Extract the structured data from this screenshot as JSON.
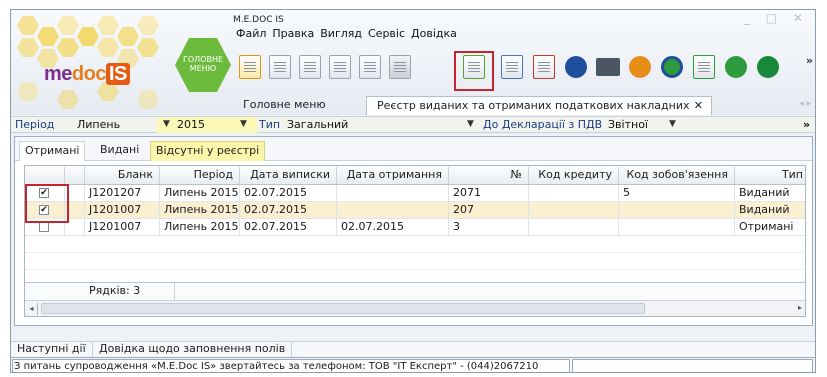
{
  "window": {
    "title": "M.E.DOC IS",
    "controls": "_ □ ✕"
  },
  "logo": {
    "me": "me",
    "doc": "doc",
    "is": "IS",
    "main_menu_line1": "ГОЛОВНЕ",
    "main_menu_line2": "МЕНЮ"
  },
  "menubar": [
    "Файл",
    "Правка",
    "Вигляд",
    "Сервіс",
    "Довідка"
  ],
  "toolbar": {
    "more": "»",
    "icons": [
      "new-doc-icon",
      "preview-icon",
      "copy-doc-icon",
      "print-preview-icon",
      "archive-icon",
      "send-icon",
      "create-doc-icon",
      "edit-doc-icon",
      "delete-doc-icon",
      "calculator-icon",
      "print-icon",
      "export-icon",
      "search-icon",
      "sign-icon",
      "refresh-icon",
      "shield-icon"
    ]
  },
  "tabs": {
    "main_menu": "Головне меню",
    "registry": "Реєстр виданих та отриманих податкових накладних",
    "close": "✕",
    "nav": "◂ ▸"
  },
  "filters": {
    "period_label": "Період",
    "period_value": "Липень",
    "year_value": "2015",
    "type_label": "Тип",
    "type_value": "Загальний",
    "declaration_label": "До Декларації з ПДВ",
    "declaration_value": "Звітної",
    "more": "»"
  },
  "subtabs": {
    "received": "Отримані",
    "issued": "Видані",
    "missing": "Відсутні у реєстрі"
  },
  "grid": {
    "columns": [
      "Бланк",
      "Період",
      "Дата виписки",
      "Дата отримання",
      "№",
      "Код кредиту",
      "Код зобов'язення",
      "Тип"
    ],
    "rows": [
      {
        "checked": true,
        "blank": "J1201207",
        "period": "Липень 2015",
        "issue_date": "02.07.2015",
        "receive_date": "",
        "number": "2071",
        "credit_code": "",
        "liability_code": "5",
        "type": "Виданий"
      },
      {
        "checked": true,
        "blank": "J1201007",
        "period": "Липень 2015",
        "issue_date": "02.07.2015",
        "receive_date": "",
        "number": "207",
        "credit_code": "",
        "liability_code": "",
        "type": "Виданий"
      },
      {
        "checked": false,
        "blank": "J1201007",
        "period": "Липень 2015",
        "issue_date": "02.07.2015",
        "receive_date": "02.07.2015",
        "number": "3",
        "credit_code": "",
        "liability_code": "",
        "type": "Отримані"
      }
    ],
    "footer": "Рядків: 3"
  },
  "bottom_tabs": {
    "next_actions": "Наступні дії",
    "help": "Довідка щодо заповнення полів"
  },
  "status": {
    "text": "З питань супроводження «M.E.Doc IS» звертайтесь за телефоном: ТОВ \"IT Експерт\" - (044)2067210"
  },
  "colors": {
    "accent_red": "#c1272d",
    "highlight_yellow": "#fbf6a9",
    "selected_row": "#fbefd2",
    "logo_green": "#6cbb3c"
  }
}
